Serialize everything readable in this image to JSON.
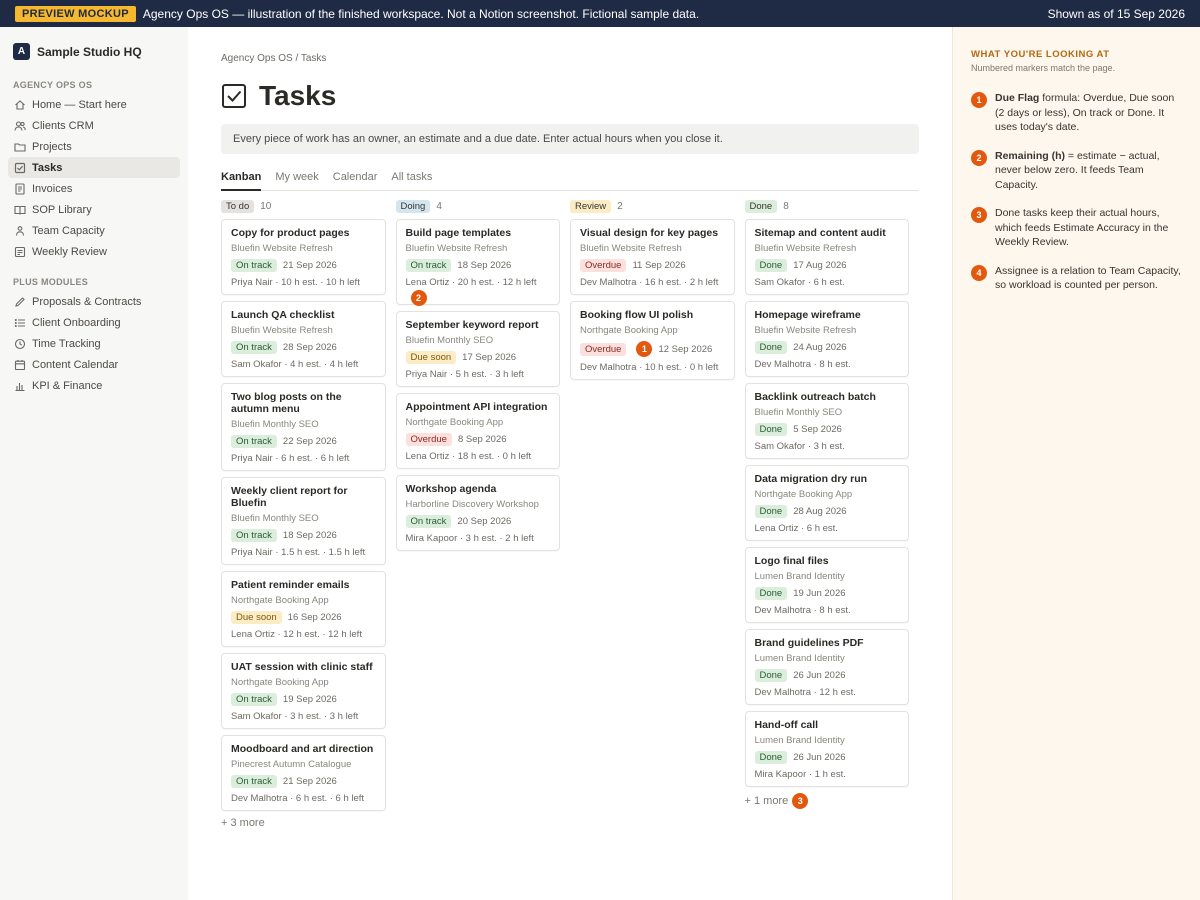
{
  "banner": {
    "badge": "PREVIEW MOCKUP",
    "text": "Agency Ops OS — illustration of the finished workspace. Not a Notion screenshot. Fictional sample data.",
    "date": "Shown as of 15 Sep 2026"
  },
  "sidebar": {
    "workspace_initial": "A",
    "workspace_name": "Sample Studio HQ",
    "section1": "AGENCY OPS OS",
    "items1": [
      "Home — Start here",
      "Clients CRM",
      "Projects",
      "Tasks",
      "Invoices",
      "SOP Library",
      "Team Capacity",
      "Weekly Review"
    ],
    "section2": "PLUS MODULES",
    "items2": [
      "Proposals & Contracts",
      "Client Onboarding",
      "Time Tracking",
      "Content Calendar",
      "KPI & Finance"
    ]
  },
  "main": {
    "breadcrumb": "Agency Ops OS / Tasks",
    "title": "Tasks",
    "callout": "Every piece of work has an owner, an estimate and a due date. Enter actual hours when you close it.",
    "tabs": [
      "Kanban",
      "My week",
      "Calendar",
      "All tasks"
    ]
  },
  "board": {
    "todo": {
      "label": "To do",
      "count": "10",
      "more": "+ 3 more",
      "cards": [
        {
          "title": "Copy for product pages",
          "client": "Bluefin Website Refresh",
          "status": "On track",
          "date": "21 Sep 2026",
          "meta": "Priya Nair · 10 h est. · 10 h left"
        },
        {
          "title": "Launch QA checklist",
          "client": "Bluefin Website Refresh",
          "status": "On track",
          "date": "28 Sep 2026",
          "meta": "Sam Okafor · 4 h est. · 4 h left"
        },
        {
          "title": "Two blog posts on the autumn menu",
          "client": "Bluefin Monthly SEO",
          "status": "On track",
          "date": "22 Sep 2026",
          "meta": "Priya Nair · 6 h est. · 6 h left"
        },
        {
          "title": "Weekly client report for Bluefin",
          "client": "Bluefin Monthly SEO",
          "status": "On track",
          "date": "18 Sep 2026",
          "meta": "Priya Nair · 1.5 h est. · 1.5 h left"
        },
        {
          "title": "Patient reminder emails",
          "client": "Northgate Booking App",
          "status": "Due soon",
          "date": "16 Sep 2026",
          "meta": "Lena Ortiz · 12 h est. · 12 h left"
        },
        {
          "title": "UAT session with clinic staff",
          "client": "Northgate Booking App",
          "status": "On track",
          "date": "19 Sep 2026",
          "meta": "Sam Okafor · 3 h est. · 3 h left"
        },
        {
          "title": "Moodboard and art direction",
          "client": "Pinecrest Autumn Catalogue",
          "status": "On track",
          "date": "21 Sep 2026",
          "meta": "Dev Malhotra · 6 h est. · 6 h left"
        }
      ]
    },
    "doing": {
      "label": "Doing",
      "count": "4",
      "cards": [
        {
          "title": "Build page templates",
          "client": "Bluefin Website Refresh",
          "status": "On track",
          "date": "18 Sep 2026",
          "meta": "Lena Ortiz · 20 h est. · 12 h left",
          "marker": "2"
        },
        {
          "title": "September keyword report",
          "client": "Bluefin Monthly SEO",
          "status": "Due soon",
          "date": "17 Sep 2026",
          "meta": "Priya Nair · 5 h est. · 3 h left"
        },
        {
          "title": "Appointment API integration",
          "client": "Northgate Booking App",
          "status": "Overdue",
          "date": "8 Sep 2026",
          "meta": "Lena Ortiz · 18 h est. · 0 h left"
        },
        {
          "title": "Workshop agenda",
          "client": "Harborline Discovery Workshop",
          "status": "On track",
          "date": "20 Sep 2026",
          "meta": "Mira Kapoor · 3 h est. · 2 h left"
        }
      ]
    },
    "review": {
      "label": "Review",
      "count": "2",
      "cards": [
        {
          "title": "Visual design for key pages",
          "client": "Bluefin Website Refresh",
          "status": "Overdue",
          "date": "11 Sep 2026",
          "meta": "Dev Malhotra · 16 h est. · 2 h left"
        },
        {
          "title": "Booking flow UI polish",
          "client": "Northgate Booking App",
          "status": "Overdue",
          "date": "12 Sep 2026",
          "meta": "Dev Malhotra · 10 h est. · 0 h left",
          "marker": "1"
        }
      ]
    },
    "done": {
      "label": "Done",
      "count": "8",
      "more": "+ 1 more",
      "more_marker": "3",
      "cards": [
        {
          "title": "Sitemap and content audit",
          "client": "Bluefin Website Refresh",
          "status": "Done",
          "date": "17 Aug 2026",
          "meta": "Sam Okafor · 6 h est."
        },
        {
          "title": "Homepage wireframe",
          "client": "Bluefin Website Refresh",
          "status": "Done",
          "date": "24 Aug 2026",
          "meta": "Dev Malhotra · 8 h est."
        },
        {
          "title": "Backlink outreach batch",
          "client": "Bluefin Monthly SEO",
          "status": "Done",
          "date": "5 Sep 2026",
          "meta": "Sam Okafor · 3 h est."
        },
        {
          "title": "Data migration dry run",
          "client": "Northgate Booking App",
          "status": "Done",
          "date": "28 Aug 2026",
          "meta": "Lena Ortiz · 6 h est."
        },
        {
          "title": "Logo final files",
          "client": "Lumen Brand Identity",
          "status": "Done",
          "date": "19 Jun 2026",
          "meta": "Dev Malhotra · 8 h est."
        },
        {
          "title": "Brand guidelines PDF",
          "client": "Lumen Brand Identity",
          "status": "Done",
          "date": "26 Jun 2026",
          "meta": "Dev Malhotra · 12 h est."
        },
        {
          "title": "Hand-off call",
          "client": "Lumen Brand Identity",
          "status": "Done",
          "date": "26 Jun 2026",
          "meta": "Mira Kapoor · 1 h est."
        }
      ]
    }
  },
  "panel": {
    "heading": "WHAT YOU'RE LOOKING AT",
    "sub": "Numbered markers match the page.",
    "notes": [
      {
        "num": "1",
        "bold": "Due Flag",
        "text": " formula: Overdue, Due soon (2 days or less), On track or Done. It uses today's date."
      },
      {
        "num": "2",
        "bold": "Remaining (h)",
        "text": " = estimate − actual, never below zero. It feeds Team Capacity."
      },
      {
        "num": "3",
        "bold": "",
        "text": "Done tasks keep their actual hours, which feeds Estimate Accuracy in the Weekly Review."
      },
      {
        "num": "4",
        "bold": "",
        "text": "Assignee is a relation to Team Capacity, so workload is counted per person."
      }
    ]
  },
  "colors": {
    "banner_bg": "#1f2a44",
    "badge": "#f5b82e",
    "marker": "#e2580e",
    "todo_pill": "#e3e2e0",
    "doing_pill": "#d3e5ef",
    "review_pill": "#fbecc6",
    "done_pill": "#dbeddb"
  }
}
